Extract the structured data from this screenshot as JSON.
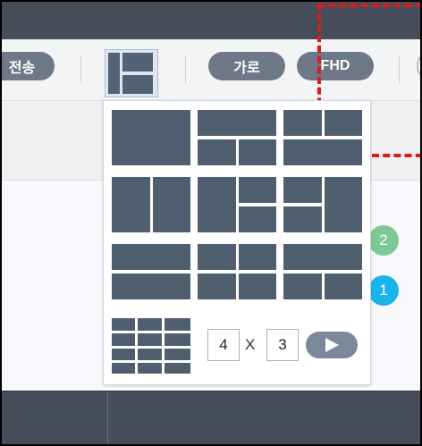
{
  "toolbar": {
    "send_label": "전송",
    "orientation_label": "가로",
    "resolution_label": "FHD"
  },
  "badges": [
    "2",
    "1"
  ],
  "colors": {
    "topbar": "#474d59",
    "pill": "#6f7887",
    "layout_tile": "#505f70",
    "badge_green": "#7cc995",
    "badge_blue": "#19b4ea",
    "highlight_dash": "#e01919"
  },
  "layout_popup": {
    "custom_rows": "4",
    "cols_separator": "X",
    "custom_cols": "3",
    "apply_icon": "play-icon"
  }
}
